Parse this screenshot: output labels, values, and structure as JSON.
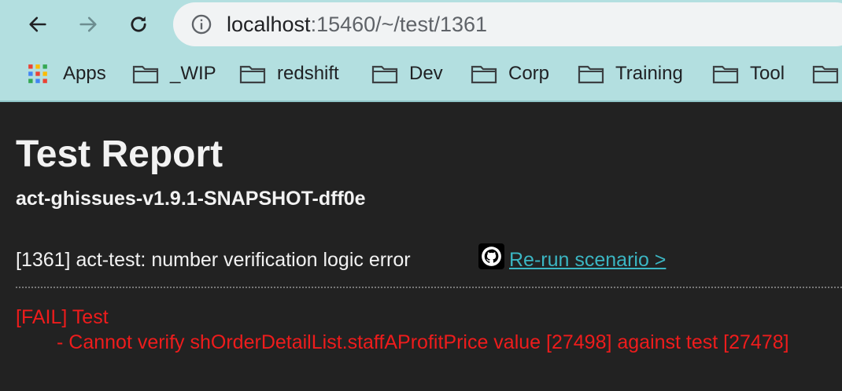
{
  "browser": {
    "url_host": "localhost",
    "url_rest": ":15460/~/test/1361",
    "bookmarks": [
      "Apps",
      "_WIP",
      "redshift",
      "Dev",
      "Corp",
      "Training",
      "Tool"
    ],
    "icons": {
      "back": "back-arrow-icon",
      "forward": "forward-arrow-icon",
      "reload": "reload-icon",
      "info": "info-icon",
      "apps": "apps-grid-icon",
      "folder": "folder-icon"
    }
  },
  "report": {
    "title": "Test Report",
    "subtitle": "act-ghissues-v1.9.1-SNAPSHOT-dff0e",
    "scenario": "[1361] act-test: number verification logic error",
    "rerun_label": "Re-run scenario >",
    "github_icon": "github-icon",
    "fail_line": "[FAIL] Test",
    "fail_detail": "- Cannot verify shOrderDetailList.staffAProfitPrice value [27498] against test [27478]"
  },
  "colors": {
    "page_bg": "#222222",
    "chrome_bg": "#b3dfe0",
    "text": "#f2f2f2",
    "link": "#3bb6c3",
    "fail": "#ee1c1c"
  }
}
